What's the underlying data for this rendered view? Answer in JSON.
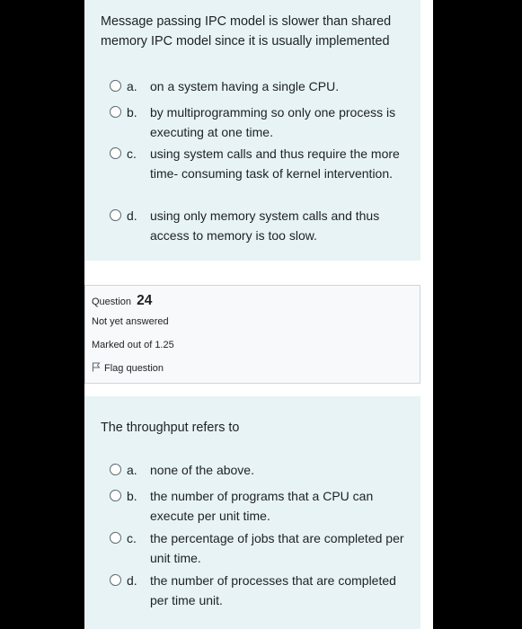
{
  "question_23": {
    "text": "Message passing IPC model is slower than shared memory IPC model since it is usually implemented",
    "answers": [
      {
        "letter": "a.",
        "text": "on a system having a single CPU."
      },
      {
        "letter": "b.",
        "text": "by multiprogramming so only one process is executing at one time."
      },
      {
        "letter": "c.",
        "text": "using system calls and thus require the more time- consuming task of kernel intervention."
      },
      {
        "letter": "d.",
        "text": "using only memory system calls and thus access to memory is too slow."
      }
    ]
  },
  "question_24": {
    "info": {
      "label": "Question",
      "number": "24",
      "state": "Not yet answered",
      "grade": "Marked out of 1.25",
      "flag_label": "Flag question"
    },
    "text": "The throughput refers to",
    "answers": [
      {
        "letter": "a.",
        "text": "none of the above."
      },
      {
        "letter": "b.",
        "text": "the number of programs that a CPU can execute per unit time."
      },
      {
        "letter": "c.",
        "text": "the percentage of jobs that are completed per unit time."
      },
      {
        "letter": "d.",
        "text": "the number of processes that are completed per time unit."
      }
    ]
  },
  "icons": {
    "radio": "radio-button-icon",
    "flag": "flag-icon"
  },
  "colors": {
    "question_background": "#e7f3f5",
    "info_background": "#f8f9fa",
    "text": "#1d2125",
    "outer_background": "#000000"
  }
}
